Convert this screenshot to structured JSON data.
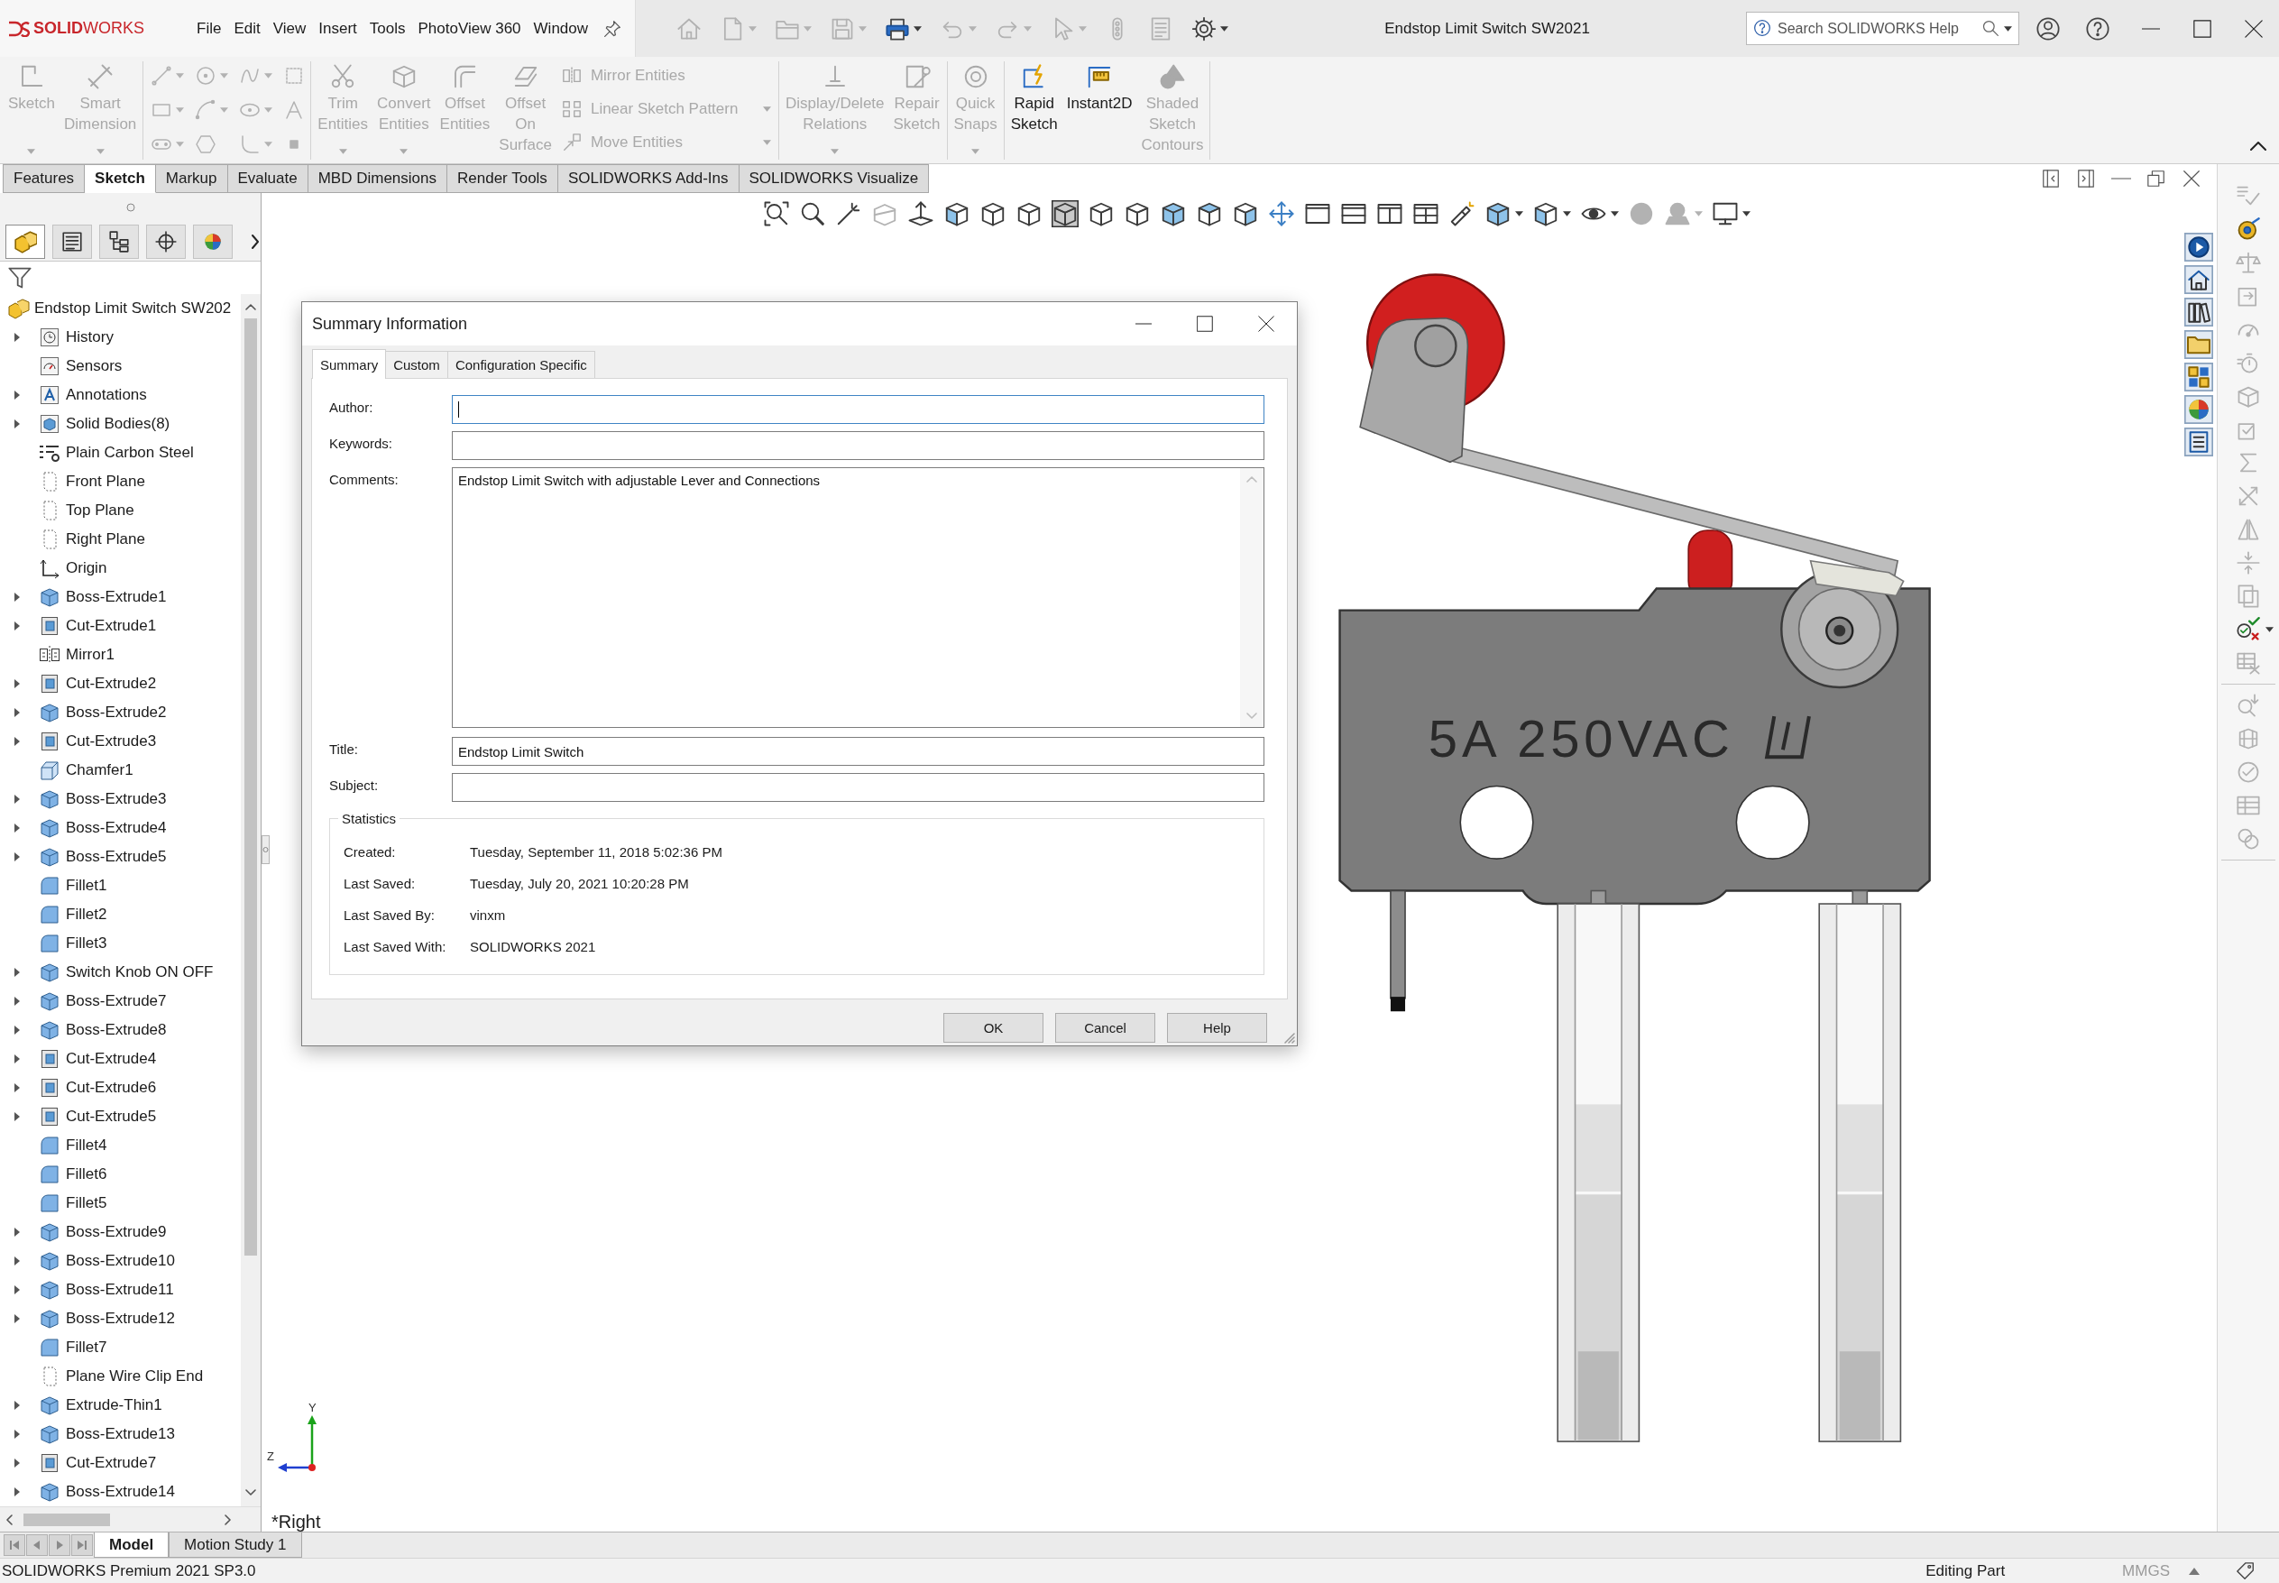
{
  "app": {
    "logo": "**SOLID**WORKS",
    "menu": [
      "File",
      "Edit",
      "View",
      "Insert",
      "Tools",
      "PhotoView 360",
      "Window"
    ],
    "title": "Endstop Limit Switch SW2021",
    "search": {
      "placeholder": "Search SOLIDWORKS Help"
    }
  },
  "quick_access": [
    {
      "disabled": true,
      "dropdown": false
    },
    {
      "disabled": true,
      "dropdown": true
    },
    {
      "disabled": true,
      "dropdown": true
    },
    {
      "disabled": true,
      "dropdown": true
    },
    {
      "disabled": false,
      "dropdown": true
    },
    {
      "disabled": true,
      "dropdown": true
    },
    {
      "disabled": true,
      "dropdown": true
    },
    {
      "disabled": true,
      "dropdown": true
    },
    {
      "disabled": true,
      "dropdown": false
    },
    {
      "disabled": true,
      "dropdown": false
    },
    {
      "disabled": false,
      "dropdown": true
    }
  ],
  "ribbon": {
    "groups": [
      [
        {
          "kind": "large",
          "label": "Sketch",
          "disabled": true,
          "dropdown": true
        },
        {
          "kind": "large",
          "label": "Smart Dimension",
          "disabled": true,
          "dropdown": true
        }
      ],
      [
        {
          "kind": "tool-grid",
          "disabled": true
        }
      ],
      [
        {
          "kind": "large",
          "label": "Trim Entities",
          "disabled": true,
          "dropdown": true
        },
        {
          "kind": "large",
          "label": "Convert Entities",
          "disabled": true,
          "dropdown": true
        },
        {
          "kind": "large",
          "label": "Offset Entities",
          "disabled": true,
          "dropdown": false
        },
        {
          "kind": "large",
          "label": "Offset On Surface",
          "disabled": true,
          "dropdown": false
        },
        {
          "kind": "stack",
          "items": [
            {
              "label": "Mirror Entities",
              "disabled": true,
              "dropdown": false
            },
            {
              "label": "Linear Sketch Pattern",
              "disabled": true,
              "dropdown": true
            },
            {
              "label": "Move Entities",
              "disabled": true,
              "dropdown": true
            }
          ]
        }
      ],
      [
        {
          "kind": "large",
          "label": "Display/Delete Relations",
          "disabled": true,
          "dropdown": true
        },
        {
          "kind": "large",
          "label": "Repair Sketch",
          "disabled": true,
          "dropdown": false
        }
      ],
      [
        {
          "kind": "large",
          "label": "Quick Snaps",
          "disabled": true,
          "dropdown": true
        }
      ],
      [
        {
          "kind": "large",
          "label": "Rapid Sketch",
          "disabled": false,
          "dropdown": false
        },
        {
          "kind": "large",
          "label": "Instant2D",
          "disabled": false,
          "dropdown": false
        },
        {
          "kind": "large",
          "label": "Shaded Sketch Contours",
          "disabled": true,
          "dropdown": false
        }
      ]
    ]
  },
  "command_tabs": [
    {
      "label": "Features",
      "selected": false
    },
    {
      "label": "Sketch",
      "selected": true
    },
    {
      "label": "Markup",
      "selected": false
    },
    {
      "label": "Evaluate",
      "selected": false
    },
    {
      "label": "MBD Dimensions",
      "selected": false
    },
    {
      "label": "Render Tools",
      "selected": false
    },
    {
      "label": "SOLIDWORKS Add-Ins",
      "selected": false
    },
    {
      "label": "SOLIDWORKS Visualize",
      "selected": false
    }
  ],
  "panel_tabs": [
    {
      "selected": true
    },
    {
      "selected": false
    },
    {
      "selected": false
    },
    {
      "selected": false
    },
    {
      "selected": false
    }
  ],
  "feature_tree": {
    "root": "Endstop Limit Switch SW202",
    "items": [
      {
        "label": "History",
        "kind": "history",
        "expandable": true
      },
      {
        "label": "Sensors",
        "kind": "sensors",
        "expandable": false
      },
      {
        "label": "Annotations",
        "kind": "annotations",
        "expandable": true
      },
      {
        "label": "Solid Bodies(8)",
        "kind": "bodies",
        "expandable": true
      },
      {
        "label": "Plain Carbon Steel",
        "kind": "material",
        "expandable": false
      },
      {
        "label": "Front Plane",
        "kind": "plane",
        "expandable": false
      },
      {
        "label": "Top Plane",
        "kind": "plane",
        "expandable": false
      },
      {
        "label": "Right Plane",
        "kind": "plane",
        "expandable": false
      },
      {
        "label": "Origin",
        "kind": "origin",
        "expandable": false
      },
      {
        "label": "Boss-Extrude1",
        "kind": "boss",
        "expandable": true
      },
      {
        "label": "Cut-Extrude1",
        "kind": "cut",
        "expandable": true
      },
      {
        "label": "Mirror1",
        "kind": "mirror",
        "expandable": false
      },
      {
        "label": "Cut-Extrude2",
        "kind": "cut",
        "expandable": true
      },
      {
        "label": "Boss-Extrude2",
        "kind": "boss",
        "expandable": true
      },
      {
        "label": "Cut-Extrude3",
        "kind": "cut",
        "expandable": true
      },
      {
        "label": "Chamfer1",
        "kind": "chamfer",
        "expandable": false
      },
      {
        "label": "Boss-Extrude3",
        "kind": "boss",
        "expandable": true
      },
      {
        "label": "Boss-Extrude4",
        "kind": "boss",
        "expandable": true
      },
      {
        "label": "Boss-Extrude5",
        "kind": "boss",
        "expandable": true
      },
      {
        "label": "Fillet1",
        "kind": "fillet",
        "expandable": false
      },
      {
        "label": "Fillet2",
        "kind": "fillet",
        "expandable": false
      },
      {
        "label": "Fillet3",
        "kind": "fillet",
        "expandable": false
      },
      {
        "label": "Switch Knob ON OFF",
        "kind": "boss",
        "expandable": true
      },
      {
        "label": "Boss-Extrude7",
        "kind": "boss",
        "expandable": true
      },
      {
        "label": "Boss-Extrude8",
        "kind": "boss",
        "expandable": true
      },
      {
        "label": "Cut-Extrude4",
        "kind": "cut",
        "expandable": true
      },
      {
        "label": "Cut-Extrude6",
        "kind": "cut",
        "expandable": true
      },
      {
        "label": "Cut-Extrude5",
        "kind": "cut",
        "expandable": true
      },
      {
        "label": "Fillet4",
        "kind": "fillet",
        "expandable": false
      },
      {
        "label": "Fillet6",
        "kind": "fillet",
        "expandable": false
      },
      {
        "label": "Fillet5",
        "kind": "fillet",
        "expandable": false
      },
      {
        "label": "Boss-Extrude9",
        "kind": "boss",
        "expandable": true
      },
      {
        "label": "Boss-Extrude10",
        "kind": "boss",
        "expandable": true
      },
      {
        "label": "Boss-Extrude11",
        "kind": "boss",
        "expandable": true
      },
      {
        "label": "Boss-Extrude12",
        "kind": "boss",
        "expandable": true
      },
      {
        "label": "Fillet7",
        "kind": "fillet",
        "expandable": false
      },
      {
        "label": "Plane Wire Clip End",
        "kind": "plane",
        "expandable": false
      },
      {
        "label": "Extrude-Thin1",
        "kind": "boss",
        "expandable": true
      },
      {
        "label": "Boss-Extrude13",
        "kind": "boss",
        "expandable": true
      },
      {
        "label": "Cut-Extrude7",
        "kind": "cut",
        "expandable": true
      },
      {
        "label": "Boss-Extrude14",
        "kind": "boss",
        "expandable": true
      }
    ]
  },
  "view_toolbar": [
    {
      "pressed": false,
      "disabled": false,
      "dropdown": false
    },
    {
      "pressed": false,
      "disabled": false,
      "dropdown": false
    },
    {
      "pressed": false,
      "disabled": false,
      "dropdown": false
    },
    {
      "pressed": false,
      "disabled": true,
      "dropdown": false
    },
    {
      "pressed": false,
      "disabled": false,
      "dropdown": false
    },
    {
      "pressed": false,
      "disabled": false,
      "dropdown": false
    },
    {
      "pressed": false,
      "disabled": false,
      "dropdown": false
    },
    {
      "pressed": false,
      "disabled": false,
      "dropdown": false
    },
    {
      "pressed": true,
      "disabled": false,
      "dropdown": false
    },
    {
      "pressed": false,
      "disabled": false,
      "dropdown": false
    },
    {
      "pressed": false,
      "disabled": false,
      "dropdown": false
    },
    {
      "pressed": false,
      "disabled": false,
      "dropdown": false
    },
    {
      "pressed": false,
      "disabled": false,
      "dropdown": false
    },
    {
      "pressed": false,
      "disabled": false,
      "dropdown": false
    },
    {
      "pressed": false,
      "disabled": false,
      "dropdown": false
    },
    {
      "pressed": false,
      "disabled": false,
      "dropdown": false
    },
    {
      "pressed": false,
      "disabled": false,
      "dropdown": false
    },
    {
      "pressed": false,
      "disabled": false,
      "dropdown": false
    },
    {
      "pressed": false,
      "disabled": false,
      "dropdown": false
    },
    {
      "pressed": false,
      "disabled": false,
      "dropdown": false
    },
    {
      "pressed": false,
      "disabled": false,
      "dropdown": true
    },
    {
      "pressed": false,
      "disabled": false,
      "dropdown": true
    },
    {
      "pressed": false,
      "disabled": false,
      "dropdown": true
    },
    {
      "pressed": false,
      "disabled": true,
      "dropdown": false
    },
    {
      "pressed": false,
      "disabled": true,
      "dropdown": true
    },
    {
      "pressed": false,
      "disabled": false,
      "dropdown": true
    }
  ],
  "dialog": {
    "title": "Summary Information",
    "tabs": [
      {
        "label": "Summary",
        "selected": true
      },
      {
        "label": "Custom",
        "selected": false
      },
      {
        "label": "Configuration Specific",
        "selected": false
      }
    ],
    "fields": [
      {
        "label": "Author:",
        "kind": "line",
        "focused": true
      },
      {
        "label": "Keywords:",
        "kind": "line",
        "focused": false
      },
      {
        "label": "Comments:",
        "kind": "multiline",
        "focused": false,
        "value": "Endstop Limit Switch with adjustable Lever and Connections"
      },
      {
        "label": "Title:",
        "kind": "line",
        "focused": false,
        "value": "Endstop Limit Switch"
      },
      {
        "label": "Subject:",
        "kind": "line",
        "focused": false
      }
    ],
    "statistics": {
      "title": "Statistics",
      "rows": [
        {
          "label": "Created:",
          "value": "Tuesday, September 11, 2018 5:02:36 PM"
        },
        {
          "label": "Last Saved:",
          "value": "Tuesday, July 20, 2021 10:20:28 PM"
        },
        {
          "label": "Last Saved By:",
          "value": "vinxm"
        },
        {
          "label": "Last Saved With:",
          "value": "SOLIDWORKS 2021"
        }
      ]
    },
    "buttons": [
      "OK",
      "Cancel",
      "Help"
    ]
  },
  "model": {
    "marking": "5A 250VAC"
  },
  "triad": {
    "y_label": "Y",
    "z_label": "Z"
  },
  "view_label": "*Right",
  "tools_strip": [
    {
      "disabled": true,
      "dropdown": false
    },
    {
      "disabled": false,
      "dropdown": false
    },
    {
      "disabled": true,
      "dropdown": false
    },
    {
      "disabled": true,
      "dropdown": false
    },
    {
      "disabled": true,
      "dropdown": false
    },
    {
      "disabled": true,
      "dropdown": false
    },
    {
      "disabled": true,
      "dropdown": false
    },
    {
      "disabled": true,
      "dropdown": false
    },
    {
      "disabled": true,
      "dropdown": false
    },
    {
      "disabled": true,
      "dropdown": false
    },
    {
      "disabled": true,
      "dropdown": false
    },
    {
      "disabled": true,
      "dropdown": false
    },
    {
      "disabled": true,
      "dropdown": false
    },
    {
      "disabled": false,
      "dropdown": true
    },
    {
      "disabled": true,
      "dropdown": false
    },
    {
      "disabled": true,
      "dropdown": false
    },
    {
      "disabled": true,
      "dropdown": false
    },
    {
      "disabled": true,
      "dropdown": false
    },
    {
      "disabled": true,
      "dropdown": false
    },
    {
      "disabled": true,
      "dropdown": false
    }
  ],
  "bottom_tabs": [
    {
      "label": "Model",
      "selected": true
    },
    {
      "label": "Motion Study 1",
      "selected": false
    }
  ],
  "status_bar": {
    "product": "SOLIDWORKS Premium 2021 SP3.0",
    "mode": "Editing Part",
    "units": "MMGS"
  }
}
